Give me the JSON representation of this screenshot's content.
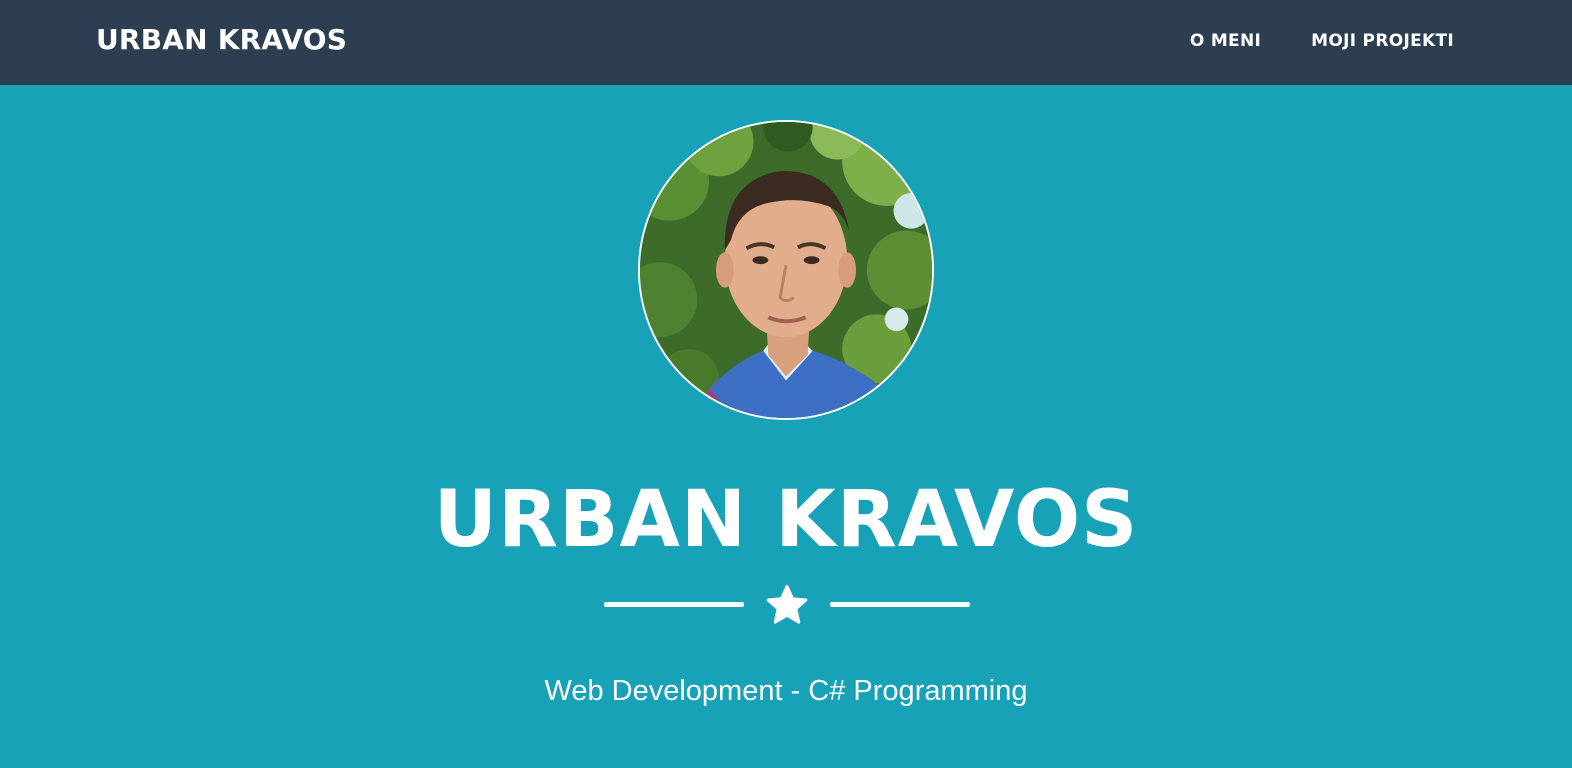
{
  "navbar": {
    "brand": "URBAN KRAVOS",
    "links": [
      {
        "label": "O MENI"
      },
      {
        "label": "MOJI PROJEKTI"
      }
    ]
  },
  "masthead": {
    "avatar_icon": "profile-photo",
    "title": "URBAN KRAVOS",
    "divider_icon": "star-icon",
    "subtitle": "Web Development - C# Programming"
  },
  "colors": {
    "navbar_bg": "#2d3e50",
    "masthead_bg": "#18a2b8",
    "text": "#ffffff"
  }
}
